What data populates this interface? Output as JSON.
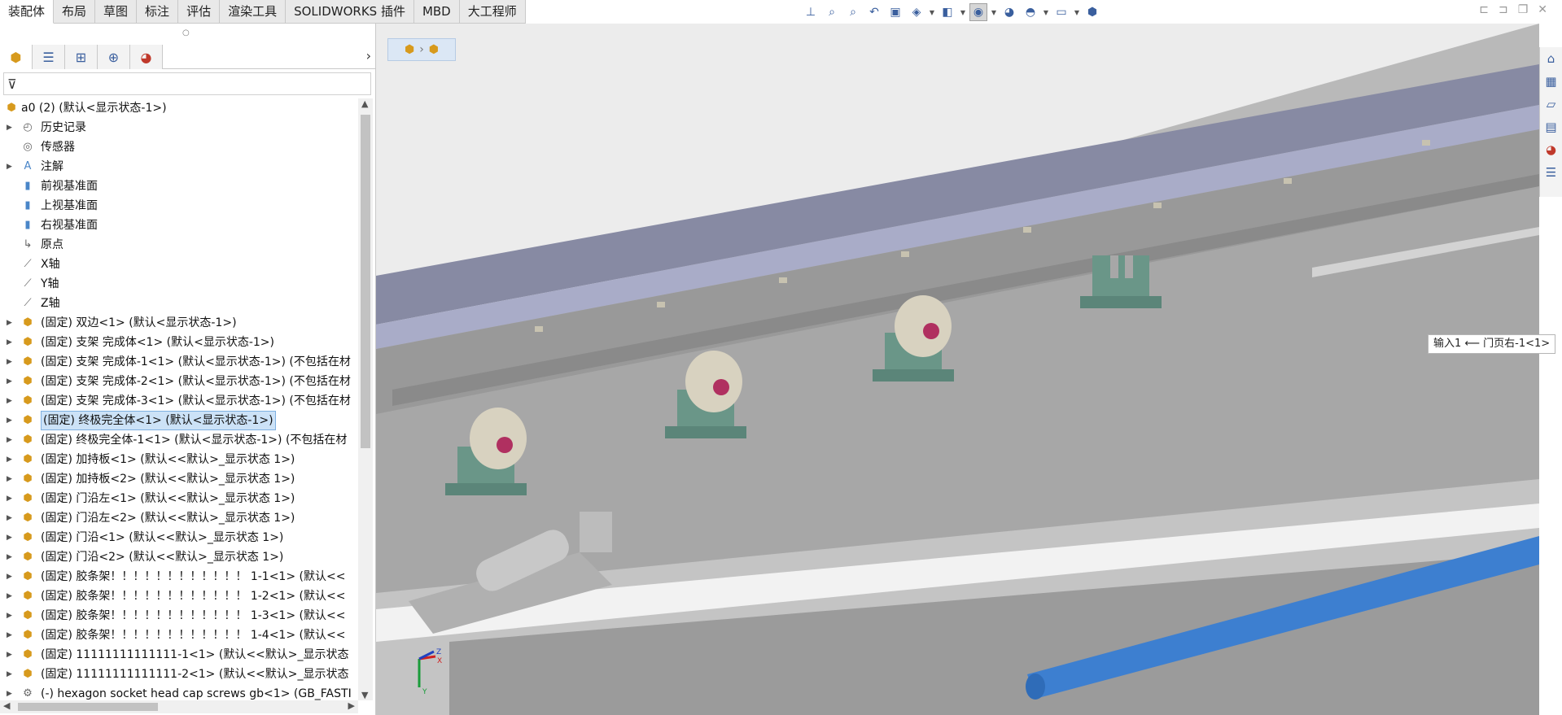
{
  "ribbon": {
    "tabs": [
      {
        "label": "装配体",
        "active": true
      },
      {
        "label": "布局",
        "active": false
      },
      {
        "label": "草图",
        "active": false
      },
      {
        "label": "标注",
        "active": false
      },
      {
        "label": "评估",
        "active": false
      },
      {
        "label": "渲染工具",
        "active": false
      },
      {
        "label": "SOLIDWORKS 插件",
        "active": false
      },
      {
        "label": "MBD",
        "active": false
      },
      {
        "label": "大工程师",
        "active": false
      }
    ]
  },
  "tree": {
    "root": "a0 (2)  (默认<显示状态-1>)",
    "items": [
      {
        "label": "历史记录",
        "icon": "history-icon",
        "expandable": true
      },
      {
        "label": "传感器",
        "icon": "sensor-icon",
        "expandable": false
      },
      {
        "label": "注解",
        "icon": "annotation-icon",
        "expandable": true
      },
      {
        "label": "前视基准面",
        "icon": "plane-icon",
        "expandable": false
      },
      {
        "label": "上视基准面",
        "icon": "plane-icon",
        "expandable": false
      },
      {
        "label": "右视基准面",
        "icon": "plane-icon",
        "expandable": false
      },
      {
        "label": "原点",
        "icon": "origin-icon",
        "expandable": false
      },
      {
        "label": "X轴",
        "icon": "axis-icon",
        "expandable": false
      },
      {
        "label": "Y轴",
        "icon": "axis-icon",
        "expandable": false
      },
      {
        "label": "Z轴",
        "icon": "axis-icon",
        "expandable": false
      },
      {
        "label": "(固定) 双边<1> (默认<显示状态-1>)",
        "icon": "subassembly-icon",
        "expandable": true
      },
      {
        "label": "(固定) 支架 完成体<1> (默认<显示状态-1>)",
        "icon": "subassembly-icon",
        "expandable": true
      },
      {
        "label": "(固定) 支架 完成体-1<1> (默认<显示状态-1>) (不包括在材",
        "icon": "subassembly-icon",
        "expandable": true
      },
      {
        "label": "(固定) 支架 完成体-2<1> (默认<显示状态-1>) (不包括在材",
        "icon": "subassembly-icon",
        "expandable": true
      },
      {
        "label": "(固定) 支架 完成体-3<1> (默认<显示状态-1>) (不包括在材",
        "icon": "subassembly-icon",
        "expandable": true
      },
      {
        "label": "(固定) 终极完全体<1> (默认<显示状态-1>)",
        "icon": "subassembly-icon",
        "expandable": true,
        "selected": true
      },
      {
        "label": "(固定) 终极完全体-1<1> (默认<显示状态-1>) (不包括在材",
        "icon": "subassembly-icon",
        "expandable": true
      },
      {
        "label": "(固定) 加持板<1> (默认<<默认>_显示状态 1>)",
        "icon": "part-icon",
        "expandable": true
      },
      {
        "label": "(固定) 加持板<2> (默认<<默认>_显示状态 1>)",
        "icon": "part-icon",
        "expandable": true
      },
      {
        "label": "(固定) 门沿左<1> (默认<<默认>_显示状态 1>)",
        "icon": "part-icon",
        "expandable": true
      },
      {
        "label": "(固定) 门沿左<2> (默认<<默认>_显示状态 1>)",
        "icon": "part-icon",
        "expandable": true
      },
      {
        "label": "(固定) 门沿<1> (默认<<默认>_显示状态 1>)",
        "icon": "part-icon",
        "expandable": true
      },
      {
        "label": "(固定) 门沿<2> (默认<<默认>_显示状态 1>)",
        "icon": "part-icon",
        "expandable": true
      },
      {
        "label": "(固定) 胶条架！！！！！！！！！！！！ 1-1<1> (默认<<",
        "icon": "part-icon",
        "expandable": true
      },
      {
        "label": "(固定) 胶条架！！！！！！！！！！！！ 1-2<1> (默认<<",
        "icon": "part-icon",
        "expandable": true
      },
      {
        "label": "(固定) 胶条架！！！！！！！！！！！！ 1-3<1> (默认<<",
        "icon": "part-icon",
        "expandable": true
      },
      {
        "label": "(固定) 胶条架！！！！！！！！！！！！ 1-4<1> (默认<<",
        "icon": "part-icon",
        "expandable": true
      },
      {
        "label": "(固定) 11111111111111-1<1> (默认<<默认>_显示状态",
        "icon": "part-icon",
        "expandable": true
      },
      {
        "label": "(固定) 11111111111111-2<1> (默认<<默认>_显示状态",
        "icon": "part-icon",
        "expandable": true
      },
      {
        "label": "(-) hexagon socket head cap screws gb<1> (GB_FASTI",
        "icon": "toolbox-icon",
        "expandable": true
      }
    ]
  },
  "viewport": {
    "tooltip": "输入1 ⟵ 门页右-1<1>",
    "triad": {
      "x": "X",
      "y": "Y",
      "z": "Z"
    }
  },
  "colors": {
    "accent": "#4a86c8",
    "assembly_icon": "#d79a1d",
    "selection_bg": "#cce2f7",
    "rail_top": "#878aa3",
    "bracket": "#6a9688",
    "rod": "#3d7fd0"
  }
}
